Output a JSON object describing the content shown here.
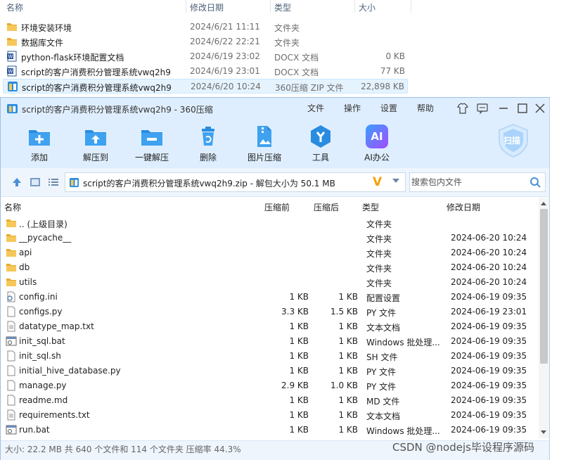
{
  "explorer": {
    "columns": {
      "name": "名称",
      "date": "修改日期",
      "type": "类型",
      "size": "大小"
    },
    "rows": [
      {
        "name": "环境安装环境",
        "date": "2024/6/21 11:11",
        "type": "文件夹",
        "size": "",
        "icon": "folder-icon"
      },
      {
        "name": "数据库文件",
        "date": "2024/6/22 22:21",
        "type": "文件夹",
        "size": "",
        "icon": "folder-icon"
      },
      {
        "name": "python-flask环境配置文档",
        "date": "2024/6/19 23:02",
        "type": "DOCX 文档",
        "size": "0 KB",
        "icon": "word-doc-icon"
      },
      {
        "name": "script的客户消费积分管理系统vwq2h9",
        "date": "2024/6/19 23:01",
        "type": "DOCX 文档",
        "size": "77 KB",
        "icon": "word-doc-icon"
      },
      {
        "name": "script的客户消费积分管理系统vwq2h9",
        "date": "2024/6/20 10:24",
        "type": "360压缩 ZIP 文件",
        "size": "22,898 KB",
        "icon": "zip-archive-icon",
        "selected": true
      }
    ]
  },
  "window": {
    "title": "script的客户消费积分管理系统vwq2h9 - 360压缩",
    "menu": [
      "文件",
      "操作",
      "设置",
      "帮助"
    ],
    "toolbar": [
      {
        "label": "添加",
        "icon": "add-icon"
      },
      {
        "label": "解压到",
        "icon": "extract-to-icon"
      },
      {
        "label": "一键解压",
        "icon": "one-click-extract-icon"
      },
      {
        "label": "删除",
        "icon": "delete-icon"
      },
      {
        "label": "图片压缩",
        "icon": "image-compress-icon"
      },
      {
        "label": "工具",
        "icon": "tools-icon"
      },
      {
        "label": "AI办公",
        "icon": "ai-office-icon"
      }
    ],
    "scan_label": "扫描",
    "ai_badge": "AI",
    "path": "script的客户消费积分管理系统vwq2h9.zip - 解包大小为 50.1 MB",
    "search_placeholder": "搜索包内文件",
    "list_columns": {
      "name": "名称",
      "compressed_before": "压缩前",
      "compressed_after": "压缩后",
      "type": "类型",
      "modified": "修改日期"
    },
    "files": [
      {
        "name": ".. (上级目录)",
        "before": "",
        "after": "",
        "type": "文件夹",
        "date": "",
        "icon": "folder-icon"
      },
      {
        "name": "__pycache__",
        "before": "",
        "after": "",
        "type": "文件夹",
        "date": "2024-06-20 10:24",
        "icon": "folder-icon"
      },
      {
        "name": "api",
        "before": "",
        "after": "",
        "type": "文件夹",
        "date": "2024-06-20 10:24",
        "icon": "folder-icon"
      },
      {
        "name": "db",
        "before": "",
        "after": "",
        "type": "文件夹",
        "date": "2024-06-20 10:24",
        "icon": "folder-icon"
      },
      {
        "name": "utils",
        "before": "",
        "after": "",
        "type": "文件夹",
        "date": "2024-06-20 10:24",
        "icon": "folder-icon"
      },
      {
        "name": "config.ini",
        "before": "1 KB",
        "after": "1 KB",
        "type": "配置设置",
        "date": "2024-06-19 09:35",
        "icon": "settings-file-icon"
      },
      {
        "name": "configs.py",
        "before": "3.3 KB",
        "after": "1.5 KB",
        "type": "PY 文件",
        "date": "2024-06-19 23:01",
        "icon": "file-icon"
      },
      {
        "name": "datatype_map.txt",
        "before": "1 KB",
        "after": "1 KB",
        "type": "文本文档",
        "date": "2024-06-19 09:35",
        "icon": "text-file-icon"
      },
      {
        "name": "init_sql.bat",
        "before": "1 KB",
        "after": "1 KB",
        "type": "Windows 批处理...",
        "date": "2024-06-19 09:35",
        "icon": "batch-file-icon"
      },
      {
        "name": "init_sql.sh",
        "before": "1 KB",
        "after": "1 KB",
        "type": "SH 文件",
        "date": "2024-06-19 09:35",
        "icon": "file-icon"
      },
      {
        "name": "initial_hive_database.py",
        "before": "1 KB",
        "after": "1 KB",
        "type": "PY 文件",
        "date": "2024-06-19 09:35",
        "icon": "file-icon"
      },
      {
        "name": "manage.py",
        "before": "2.9 KB",
        "after": "1.0 KB",
        "type": "PY 文件",
        "date": "2024-06-19 09:35",
        "icon": "file-icon"
      },
      {
        "name": "readme.md",
        "before": "1 KB",
        "after": "1 KB",
        "type": "MD 文件",
        "date": "2024-06-19 09:35",
        "icon": "file-icon"
      },
      {
        "name": "requirements.txt",
        "before": "1 KB",
        "after": "1 KB",
        "type": "文本文档",
        "date": "2024-06-19 09:35",
        "icon": "text-file-icon"
      },
      {
        "name": "run.bat",
        "before": "1 KB",
        "after": "1 KB",
        "type": "Windows 批处理...",
        "date": "2024-06-19 09:35",
        "icon": "batch-file-icon"
      }
    ],
    "status": "大小: 22.2 MB 共 640 个文件和 114 个文件夹 压缩率 44.3%"
  },
  "watermark": "CSDN @nodejs毕设程序源码",
  "colors": {
    "folder": "#f2c14e",
    "accent": "#2a8ce0",
    "titlebar": "#dfeefe",
    "selection": "#e5f3ff"
  }
}
